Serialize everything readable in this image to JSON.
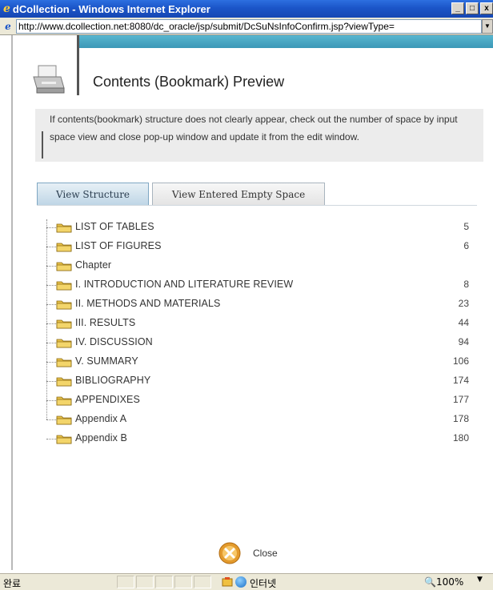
{
  "window": {
    "title": "dCollection - Windows Internet Explorer",
    "address": "http://www.dcollection.net:8080/dc_oracle/jsp/submit/DcSuNsInfoConfirm.jsp?viewType="
  },
  "page": {
    "title": "Contents (Bookmark) Preview",
    "notice": "If contents(bookmark) structure does not clearly appear, check out the number of space by input space view and close pop-up window and update it from the edit window."
  },
  "tabs": [
    {
      "label": "View Structure",
      "active": true
    },
    {
      "label": "View Entered Empty Space",
      "active": false
    }
  ],
  "tree": [
    {
      "label": "LIST OF TABLES",
      "page": "5"
    },
    {
      "label": "LIST OF FIGURES",
      "page": "6"
    },
    {
      "label": "Chapter",
      "page": ""
    },
    {
      "label": "I. INTRODUCTION AND LITERATURE REVIEW",
      "page": "8"
    },
    {
      "label": "II. METHODS AND MATERIALS",
      "page": "23"
    },
    {
      "label": "III. RESULTS",
      "page": "44"
    },
    {
      "label": "IV. DISCUSSION",
      "page": "94"
    },
    {
      "label": "V. SUMMARY",
      "page": "106"
    },
    {
      "label": "BIBLIOGRAPHY",
      "page": "174"
    },
    {
      "label": "APPENDIXES",
      "page": "177"
    },
    {
      "label": "Appendix A",
      "page": "178"
    },
    {
      "label": "Appendix B",
      "page": "180"
    }
  ],
  "close_label": "Close",
  "status": {
    "text": "완료",
    "zone": "인터넷",
    "zoom": "100%"
  },
  "colors": {
    "titlebar": "#1b55c8",
    "accent_stripe": "#4aa8c4",
    "active_tab": "#bfd6e6",
    "folder": "#d9b43a"
  },
  "icons": [
    "ie-logo-icon",
    "page-icon",
    "printer-icon",
    "folder-icon",
    "close-icon",
    "globe-icon",
    "zoom-icon"
  ]
}
